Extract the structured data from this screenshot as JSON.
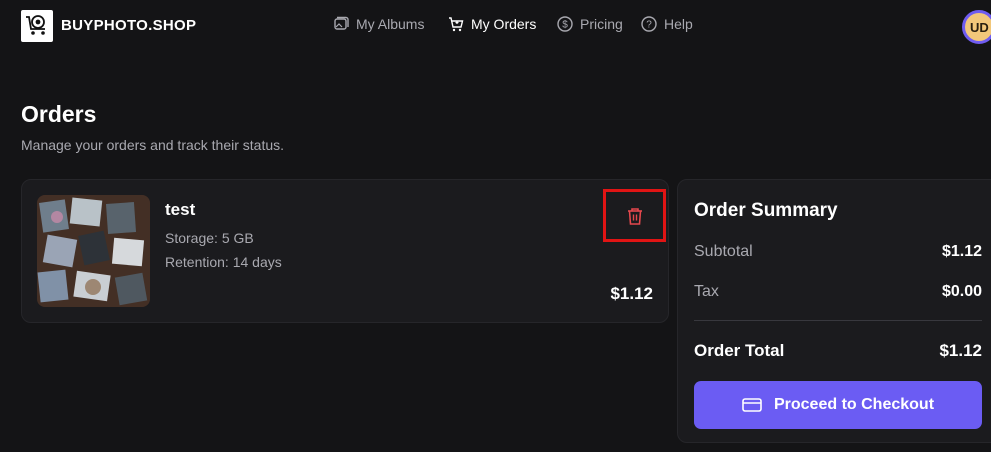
{
  "header": {
    "brand": "BUYPHOTO.SHOP",
    "nav": [
      {
        "label": "My Albums",
        "icon": "albums-icon",
        "active": false
      },
      {
        "label": "My Orders",
        "icon": "cart-icon",
        "active": true
      },
      {
        "label": "Pricing",
        "icon": "dollar-circle-icon",
        "active": false
      },
      {
        "label": "Help",
        "icon": "help-circle-icon",
        "active": false
      }
    ],
    "avatar_initials": "UD"
  },
  "page": {
    "title": "Orders",
    "subtitle": "Manage your orders and track their status."
  },
  "order_item": {
    "name": "test",
    "storage": "Storage: 5 GB",
    "retention": "Retention: 14 days",
    "price": "$1.12",
    "delete_icon": "trash-icon"
  },
  "summary": {
    "title": "Order Summary",
    "subtotal_label": "Subtotal",
    "subtotal_value": "$1.12",
    "tax_label": "Tax",
    "tax_value": "$0.00",
    "total_label": "Order Total",
    "total_value": "$1.12",
    "checkout_label": "Proceed to Checkout"
  },
  "colors": {
    "background": "#141416",
    "card": "#1b1b1e",
    "accent": "#6b5cf3",
    "delete": "#e11414"
  }
}
